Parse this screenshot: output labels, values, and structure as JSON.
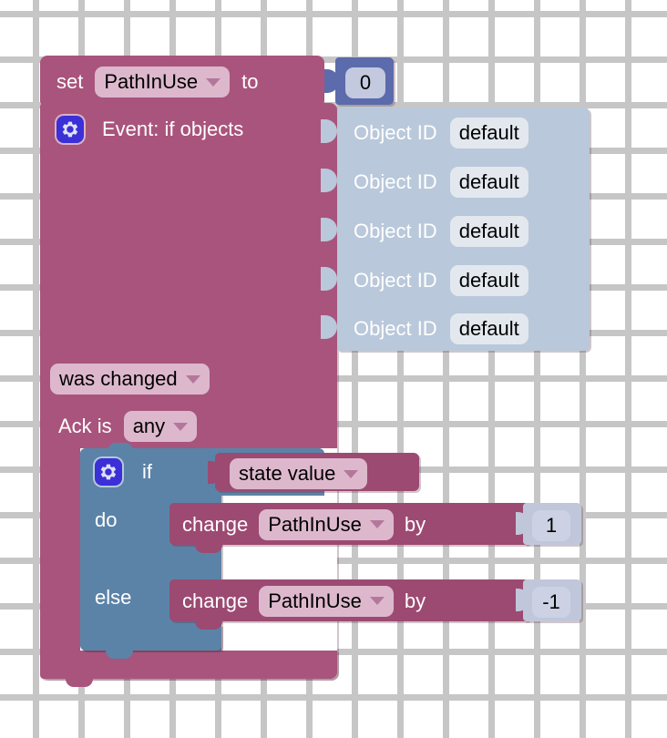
{
  "workspace": {
    "type": "blockly-visual-program",
    "background": "#ffffff",
    "grid_color": "#c6c6c6",
    "grid_spacing": 50
  },
  "colors": {
    "event_block": "#a9547c",
    "math_block": "#5b6bab",
    "object_id_block": "#b9c8da",
    "logic_block": "#5b83a8",
    "number_block": "#c0c7da",
    "field_pink": "#ddb8cd",
    "field_light": "#e3e8ee",
    "selection_outline": "#fbbf24",
    "gear_button": "#3b2fd8"
  },
  "blocks": {
    "set_block": {
      "selected": true,
      "label_set": "set",
      "variable": "PathInUse",
      "label_to": "to",
      "value": "0"
    },
    "event_block": {
      "gear_icon": "gear-icon",
      "title": "Event: if objects",
      "object_ids": [
        {
          "label": "Object ID",
          "value": "default"
        },
        {
          "label": "Object ID",
          "value": "default"
        },
        {
          "label": "Object ID",
          "value": "default"
        },
        {
          "label": "Object ID",
          "value": "default"
        },
        {
          "label": "Object ID",
          "value": "default"
        }
      ],
      "trigger": "was changed",
      "ack_label": "Ack is",
      "ack_value": "any"
    },
    "if_block": {
      "gear_icon": "gear-icon",
      "label_if": "if",
      "condition": "state value",
      "label_do": "do",
      "label_else": "else",
      "do_statement": {
        "label_change": "change",
        "variable": "PathInUse",
        "label_by": "by",
        "value": "1"
      },
      "else_statement": {
        "label_change": "change",
        "variable": "PathInUse",
        "label_by": "by",
        "value": "-1"
      }
    }
  }
}
